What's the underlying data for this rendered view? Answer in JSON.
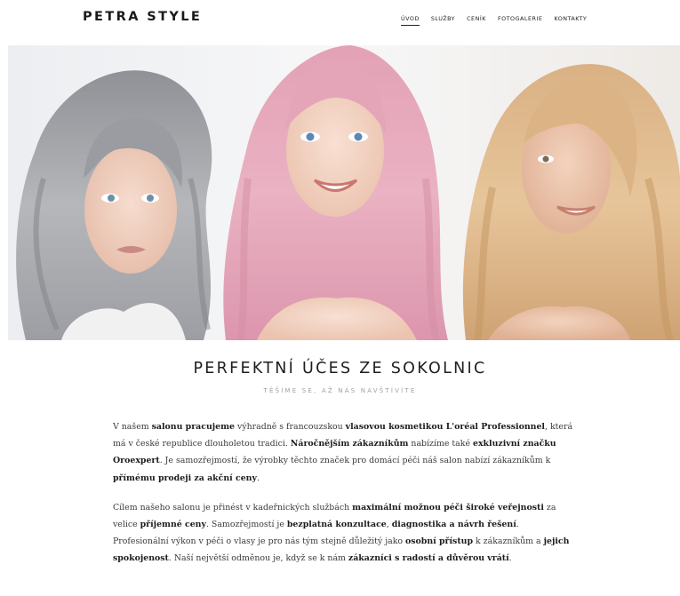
{
  "header": {
    "logo": "PETRA STYLE",
    "nav": [
      {
        "label": "ÚVOD",
        "active": true
      },
      {
        "label": "SLUŽBY",
        "active": false
      },
      {
        "label": "CENÍK",
        "active": false
      },
      {
        "label": "FOTOGALERIE",
        "active": false
      },
      {
        "label": "KONTAKTY",
        "active": false
      }
    ]
  },
  "hero": {
    "models": [
      {
        "name": "model-grey-hair",
        "hair_color": "#a9abb0"
      },
      {
        "name": "model-pink-hair",
        "hair_color": "#e6a3b8"
      },
      {
        "name": "model-blonde-hair",
        "hair_color": "#d9b184"
      }
    ],
    "background": "#f1f1f3"
  },
  "main": {
    "headline": "PERFEKTNÍ ÚČES ZE SOKOLNIC",
    "subheadline": "TĚŠÍME SE, AŽ NÁS NAVŠTÍVÍTE",
    "paragraphs": [
      [
        {
          "t": "V našem ",
          "b": false
        },
        {
          "t": "salonu pracujeme",
          "b": true
        },
        {
          "t": " výhradně s francouzskou ",
          "b": false
        },
        {
          "t": "vlasovou kosmetikou L'oréal Professionnel",
          "b": true
        },
        {
          "t": ", která má v české republice dlouholetou tradici. ",
          "b": false
        },
        {
          "t": "Náročnějším zákazníkům",
          "b": true
        },
        {
          "t": " nabízíme také ",
          "b": false
        },
        {
          "t": "exkluzivní značku Oroexpert",
          "b": true
        },
        {
          "t": ". Je samozřejmostí, že výrobky těchto značek pro domácí péči náš salon nabízí zákazníkům k ",
          "b": false
        },
        {
          "t": "přímému prodeji za akční ceny",
          "b": true
        },
        {
          "t": ".",
          "b": false
        }
      ],
      [
        {
          "t": "Cílem našeho salonu je přinést v kadeřnických službách ",
          "b": false
        },
        {
          "t": "maximální možnou péči široké veřejnosti",
          "b": true
        },
        {
          "t": " za velice ",
          "b": false
        },
        {
          "t": "příjemné ceny",
          "b": true
        },
        {
          "t": ". Samozřejmostí je ",
          "b": false
        },
        {
          "t": "bezplatná konzultace",
          "b": true
        },
        {
          "t": ", ",
          "b": false
        },
        {
          "t": "diagnostika a návrh řešení",
          "b": true
        },
        {
          "t": ". Profesionální výkon v péči o vlasy je pro nás tým stejně důležitý jako ",
          "b": false
        },
        {
          "t": "osobní přístup",
          "b": true
        },
        {
          "t": " k zákazníkům a ",
          "b": false
        },
        {
          "t": "jejich spokojenost",
          "b": true
        },
        {
          "t": ". Naší největší odměnou je, když se k nám ",
          "b": false
        },
        {
          "t": "zákazníci s radostí a důvěrou vrátí",
          "b": true
        },
        {
          "t": ".",
          "b": false
        }
      ]
    ]
  }
}
